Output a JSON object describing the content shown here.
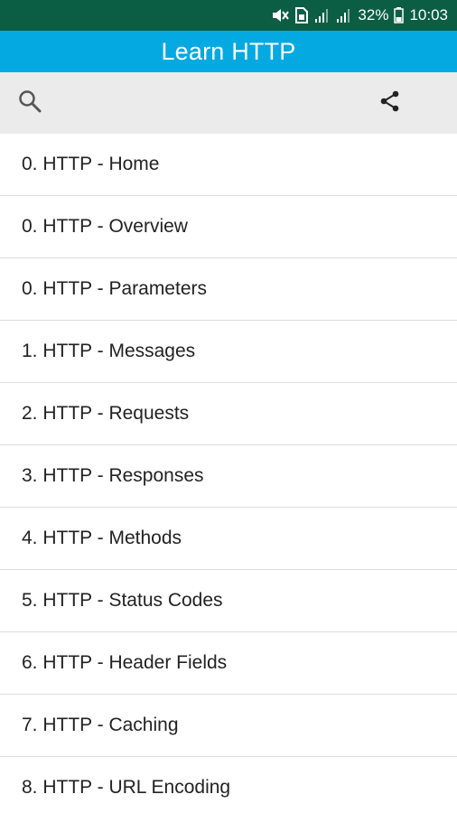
{
  "status_bar": {
    "battery_percent": "32%",
    "time": "10:03",
    "icons": [
      "mute-icon",
      "sim-icon",
      "signal-icon",
      "signal-icon",
      "battery-icon"
    ]
  },
  "app_bar": {
    "title": "Learn HTTP",
    "color": "#03a9e0"
  },
  "toolbar": {
    "search_icon": "search-icon",
    "share_icon": "share-icon"
  },
  "list": {
    "items": [
      "0. HTTP - Home",
      "0. HTTP - Overview",
      "0. HTTP - Parameters",
      "1. HTTP - Messages",
      "2. HTTP - Requests",
      "3. HTTP - Responses",
      "4. HTTP - Methods",
      "5. HTTP - Status Codes",
      "6. HTTP - Header Fields",
      "7. HTTP - Caching",
      "8. HTTP - URL Encoding"
    ]
  },
  "colors": {
    "status_bar": "#0b5e43",
    "app_bar": "#03a9e0",
    "toolbar": "#ebebeb"
  }
}
